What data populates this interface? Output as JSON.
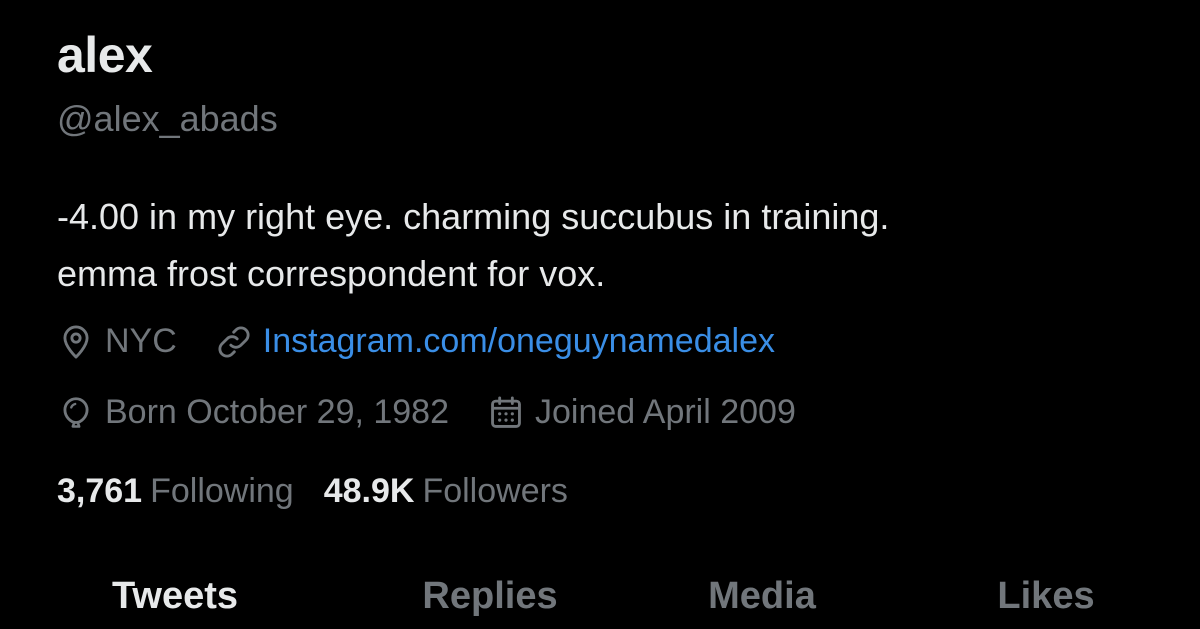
{
  "profile": {
    "display_name": "alex",
    "handle": "@alex_abads",
    "bio_lines": [
      "-4.00 in my right eye. charming succubus in training.",
      "emma frost correspondent for vox."
    ],
    "location": "NYC",
    "website": "Instagram.com/oneguynamedalex",
    "birthday": "Born October 29, 1982",
    "joined": "Joined April 2009"
  },
  "icons": {
    "location": "location-pin-icon",
    "website": "link-icon",
    "birthday": "balloon-icon",
    "joined": "calendar-icon"
  },
  "stats": {
    "following_count": "3,761",
    "following_label": "Following",
    "followers_count": "48.9K",
    "followers_label": "Followers"
  },
  "tabs": [
    {
      "label": "Tweets",
      "active": true
    },
    {
      "label": "Replies",
      "active": false
    },
    {
      "label": "Media",
      "active": false
    },
    {
      "label": "Likes",
      "active": false
    }
  ],
  "colors": {
    "background": "#000000",
    "primary_text": "#e7e9ea",
    "secondary_text": "#71767b",
    "link": "#1d9bf0"
  }
}
